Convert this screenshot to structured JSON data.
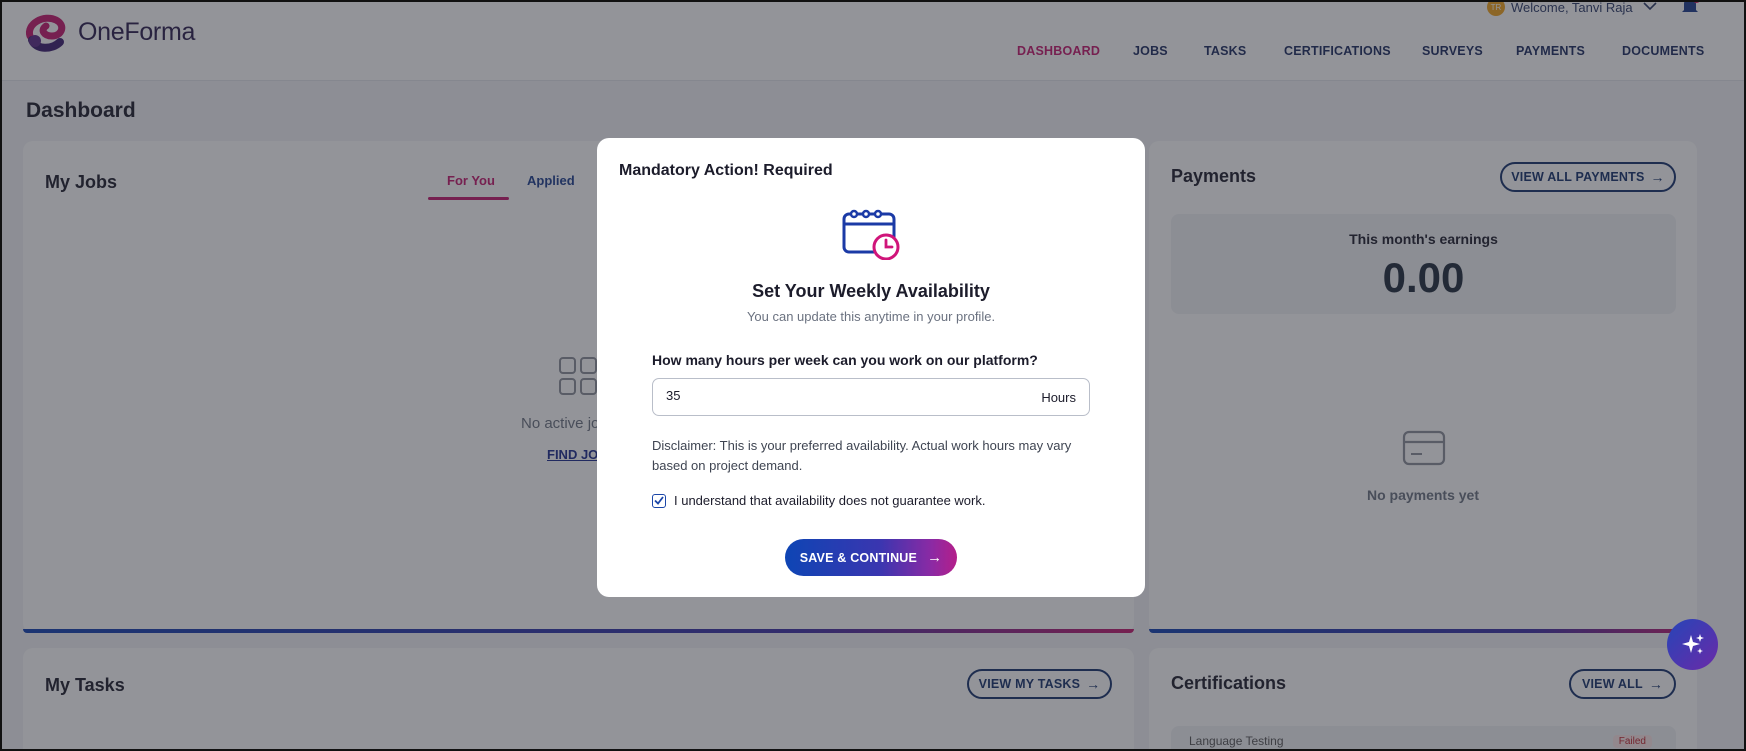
{
  "header": {
    "logo_text": "OneForma",
    "user_initials": "TR",
    "welcome_text": "Welcome, Tanvi Raja",
    "nav": [
      {
        "label": "DASHBOARD",
        "active": true
      },
      {
        "label": "JOBS",
        "active": false
      },
      {
        "label": "TASKS",
        "active": false
      },
      {
        "label": "CERTIFICATIONS",
        "active": false
      },
      {
        "label": "SURVEYS",
        "active": false
      },
      {
        "label": "PAYMENTS",
        "active": false
      },
      {
        "label": "DOCUMENTS",
        "active": false
      }
    ]
  },
  "page": {
    "title": "Dashboard"
  },
  "my_jobs": {
    "title": "My Jobs",
    "tabs": [
      "For You",
      "Applied"
    ],
    "empty_text": "No active jo",
    "find_link": "FIND JOI"
  },
  "payments": {
    "title": "Payments",
    "view_all": "VIEW ALL PAYMENTS",
    "earnings_label": "This month's earnings",
    "earnings_value": "0.00",
    "empty_text": "No payments yet"
  },
  "my_tasks": {
    "title": "My Tasks",
    "view_button": "VIEW MY TASKS"
  },
  "certifications": {
    "title": "Certifications",
    "view_all": "VIEW ALL",
    "item_name": "Language Testing",
    "item_status": "Failed"
  },
  "modal": {
    "title": "Mandatory Action! Required",
    "heading": "Set Your Weekly Availability",
    "subheading": "You can update this anytime in your profile.",
    "question": "How many hours per week can you work on our platform?",
    "hours_value": "35",
    "hours_unit": "Hours",
    "disclaimer": "Disclaimer: This is your preferred availability. Actual work hours may vary based on project demand.",
    "checkbox_label": "I understand that availability does not guarantee work.",
    "checkbox_checked": true,
    "button_label": "SAVE & CONTINUE"
  },
  "colors": {
    "accent_pink": "#c4176c",
    "navy": "#14316b",
    "brand_blue": "#0e45b4"
  }
}
